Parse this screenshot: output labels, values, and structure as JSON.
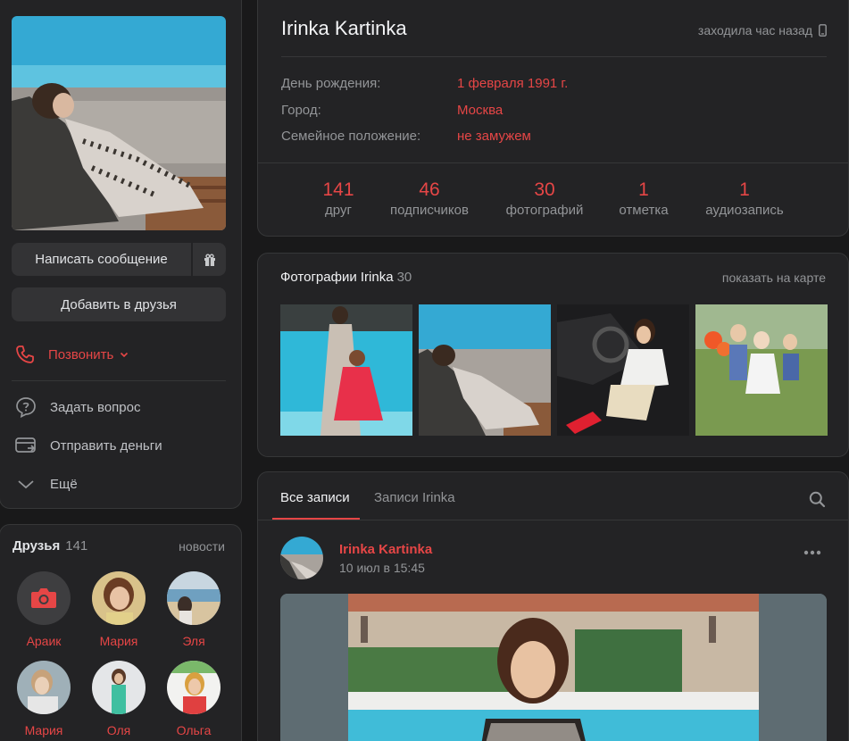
{
  "profile": {
    "name": "Irinka Kartinka",
    "last_seen": "заходила час назад",
    "send_message": "Написать сообщение",
    "add_friend": "Добавить в друзья",
    "call": "Позвонить",
    "menu": [
      {
        "label": "Задать вопрос",
        "icon": "question-icon"
      },
      {
        "label": "Отправить деньги",
        "icon": "money-icon"
      },
      {
        "label": "Ещё",
        "icon": "chevron-down-icon"
      }
    ]
  },
  "info": [
    {
      "label": "День рождения:",
      "value": "1 февраля 1991 г."
    },
    {
      "label": "Город:",
      "value": "Москва"
    },
    {
      "label": "Семейное положение:",
      "value": "не замужем"
    }
  ],
  "counters": [
    {
      "count": "141",
      "label": "друг"
    },
    {
      "count": "46",
      "label": "подписчиков"
    },
    {
      "count": "30",
      "label": "фотографий"
    },
    {
      "count": "1",
      "label": "отметка"
    },
    {
      "count": "1",
      "label": "аудиозапись"
    }
  ],
  "friends": {
    "title": "Друзья",
    "count": "141",
    "news": "новости",
    "list": [
      {
        "name": "Араик"
      },
      {
        "name": "Мария"
      },
      {
        "name": "Эля"
      },
      {
        "name": "Мария"
      },
      {
        "name": "Оля"
      },
      {
        "name": "Ольга"
      }
    ]
  },
  "photos": {
    "title": "Фотографии Irinka",
    "count": "30",
    "map_link": "показать на карте"
  },
  "wall": {
    "tab_all": "Все записи",
    "tab_own": "Записи Irinka",
    "post": {
      "author": "Irinka Kartinka",
      "date": "10 июл в 15:45"
    }
  },
  "colors": {
    "accent": "#e64646",
    "background": "#19191a",
    "card": "#232325"
  }
}
